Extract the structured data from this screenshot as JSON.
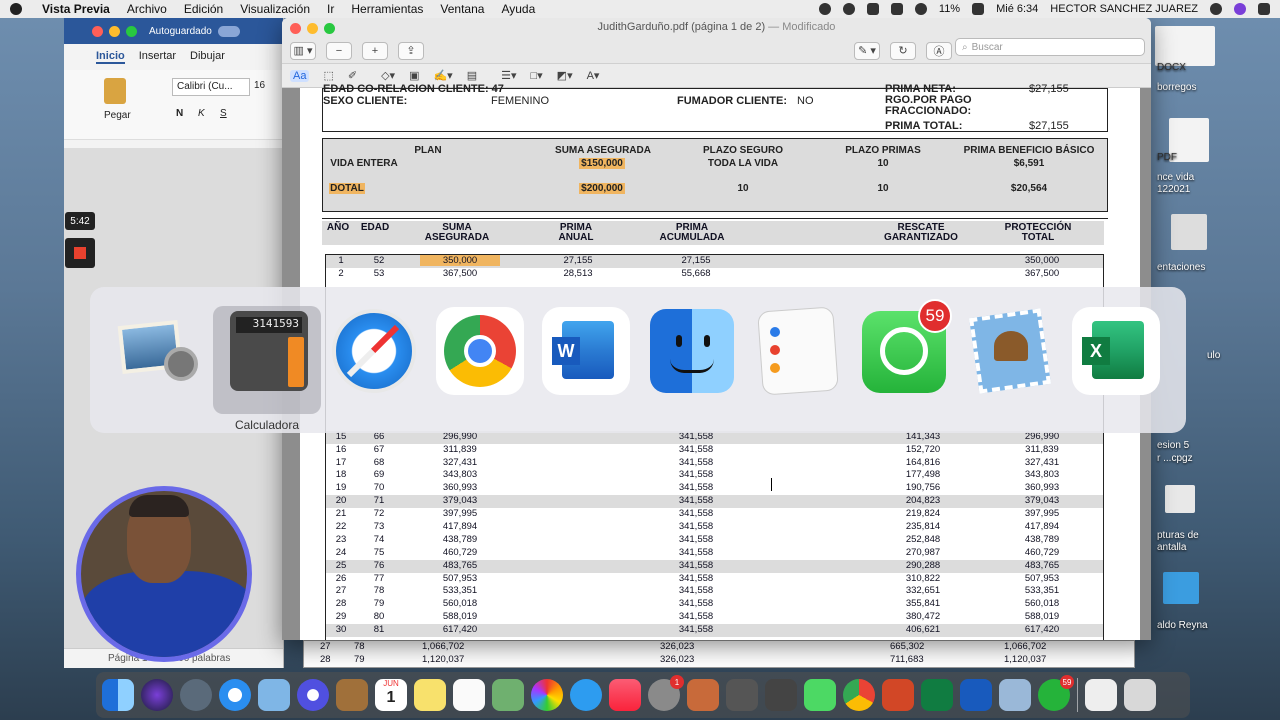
{
  "menubar": {
    "app": "Vista Previa",
    "items": [
      "Archivo",
      "Edición",
      "Visualización",
      "Ir",
      "Herramientas",
      "Ventana",
      "Ayuda"
    ],
    "battery": "11%",
    "clock": "Mié 6:34",
    "user": "HECTOR SANCHEZ JUAREZ"
  },
  "word": {
    "autosave": "Autoguardado",
    "tabs": [
      "Inicio",
      "Insertar",
      "Dibujar"
    ],
    "paste": "Pegar",
    "font": "Calibri (Cu...",
    "font_size": "16",
    "status": "Página 1 de 2   166 palabras"
  },
  "preview": {
    "filename": "JudithGarduño.pdf (página 1 de 2)",
    "modified": "— Modificado",
    "search_placeholder": "Buscar"
  },
  "pdf": {
    "row_top_left": "EDAD CO-RELACION CLIENTE: 47",
    "sexo_label": "SEXO CLIENTE:",
    "sexo_value": "FEMENINO",
    "fumador_label": "FUMADOR CLIENTE:",
    "fumador_value": "NO",
    "prima_neta_label": "PRIMA NETA:",
    "prima_neta_value": "$27,155",
    "rgo_label": "RGO.POR PAGO FRACCIONADO:",
    "prima_total_label": "PRIMA TOTAL:",
    "prima_total_value": "$27,155",
    "plan_headers": [
      "PLAN",
      "SUMA ASEGURADA",
      "PLAZO SEGURO",
      "PLAZO PRIMAS",
      "PRIMA BENEFICIO BÁSICO"
    ],
    "plan_row1": [
      "VIDA ENTERA",
      "$150,000",
      "TODA LA VIDA",
      "10",
      "$6,591"
    ],
    "plan_row2": [
      "DOTAL",
      "$200,000",
      "10",
      "10",
      "$20,564"
    ],
    "table_headers": [
      "AÑO",
      "EDAD",
      "SUMA ASEGURADA",
      "PRIMA ANUAL",
      "PRIMA ACUMULADA",
      "RESCATE GARANTIZADO",
      "PROTECCIÓN TOTAL"
    ],
    "top_rows": [
      [
        "1",
        "52",
        "350,000",
        "27,155",
        "27,155",
        "",
        "350,000"
      ],
      [
        "2",
        "53",
        "367,500",
        "28,513",
        "55,668",
        "",
        "367,500"
      ]
    ],
    "bottom_rows": [
      [
        "15",
        "66",
        "296,990",
        "",
        "341,558",
        "141,343",
        "296,990"
      ],
      [
        "16",
        "67",
        "311,839",
        "",
        "341,558",
        "152,720",
        "311,839"
      ],
      [
        "17",
        "68",
        "327,431",
        "",
        "341,558",
        "164,816",
        "327,431"
      ],
      [
        "18",
        "69",
        "343,803",
        "",
        "341,558",
        "177,498",
        "343,803"
      ],
      [
        "19",
        "70",
        "360,993",
        "",
        "341,558",
        "190,756",
        "360,993"
      ],
      [
        "20",
        "71",
        "379,043",
        "",
        "341,558",
        "204,823",
        "379,043"
      ],
      [
        "21",
        "72",
        "397,995",
        "",
        "341,558",
        "219,824",
        "397,995"
      ],
      [
        "22",
        "73",
        "417,894",
        "",
        "341,558",
        "235,814",
        "417,894"
      ],
      [
        "23",
        "74",
        "438,789",
        "",
        "341,558",
        "252,848",
        "438,789"
      ],
      [
        "24",
        "75",
        "460,729",
        "",
        "341,558",
        "270,987",
        "460,729"
      ],
      [
        "25",
        "76",
        "483,765",
        "",
        "341,558",
        "290,288",
        "483,765"
      ],
      [
        "26",
        "77",
        "507,953",
        "",
        "341,558",
        "310,822",
        "507,953"
      ],
      [
        "27",
        "78",
        "533,351",
        "",
        "341,558",
        "332,651",
        "533,351"
      ],
      [
        "28",
        "79",
        "560,018",
        "",
        "341,558",
        "355,841",
        "560,018"
      ],
      [
        "29",
        "80",
        "588,019",
        "",
        "341,558",
        "380,472",
        "588,019"
      ],
      [
        "30",
        "81",
        "617,420",
        "",
        "341,558",
        "406,621",
        "617,420"
      ]
    ],
    "under_rows": [
      [
        "27",
        "78",
        "1,066,702",
        "326,023",
        "665,302",
        "1,066,702"
      ],
      [
        "28",
        "79",
        "1,120,037",
        "326,023",
        "711,683",
        "1,120,037"
      ]
    ]
  },
  "switcher": {
    "apps": [
      "Vista Previa",
      "Calculadora",
      "Safari",
      "Google Chrome",
      "Microsoft Word",
      "Finder",
      "Recordatorios",
      "WhatsApp",
      "Mail",
      "Microsoft Excel"
    ],
    "selected_label": "Calculadora",
    "calc_display": "3141593",
    "whatsapp_badge": "59"
  },
  "desktop": {
    "labels": [
      "DOCX",
      "borregos",
      "PDF",
      "nce vida",
      "122021",
      "entaciones",
      "ulo",
      "esion 5",
      "r ...cpgz",
      "pturas de",
      "antalla",
      "aldo Reyna"
    ]
  },
  "recording": {
    "time": "5:42"
  },
  "dock": {
    "calendar_month": "JUN",
    "calendar_day": "1",
    "settings_badge": "1",
    "whatsapp_badge": "59"
  },
  "colors": {
    "accent_word": "#2b579a",
    "highlight": "#f0b560",
    "row_gray": "#dcdcdc"
  }
}
